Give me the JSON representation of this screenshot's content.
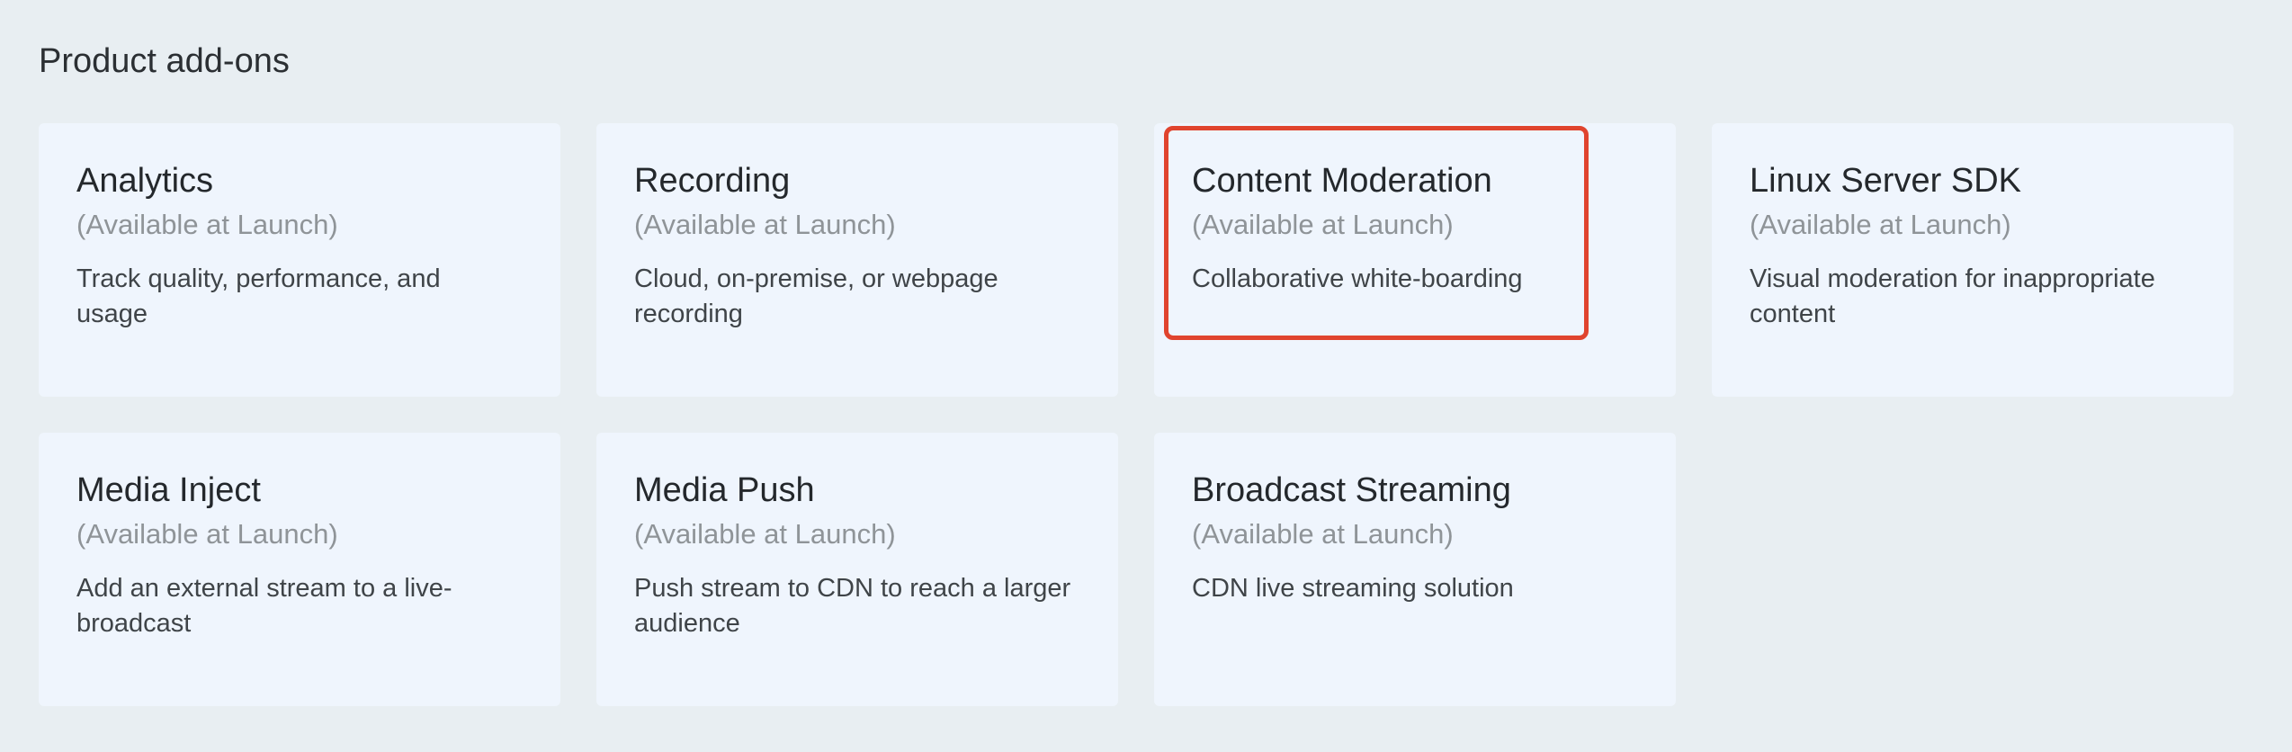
{
  "page": {
    "section_title": "Product add-ons"
  },
  "addons": [
    {
      "title": "Analytics",
      "status": "(Available at Launch)",
      "description": "Track quality, performance, and usage"
    },
    {
      "title": "Recording",
      "status": "(Available at Launch)",
      "description": "Cloud, on-premise, or webpage recording"
    },
    {
      "title": "Content Moderation",
      "status": "(Available at Launch)",
      "description": "Collaborative white-boarding"
    },
    {
      "title": "Linux Server SDK",
      "status": "(Available at Launch)",
      "description": "Visual moderation for inappropriate content"
    },
    {
      "title": "Media Inject",
      "status": "(Available at Launch)",
      "description": "Add an external stream to a live-broadcast"
    },
    {
      "title": "Media Push",
      "status": "(Available at Launch)",
      "description": "Push stream to CDN to reach a larger audience"
    },
    {
      "title": "Broadcast Streaming",
      "status": "(Available at Launch)",
      "description": "CDN live streaming solution"
    }
  ],
  "colors": {
    "background": "#e8eef2",
    "card": "#eff5fd",
    "highlight": "#e0442e"
  }
}
